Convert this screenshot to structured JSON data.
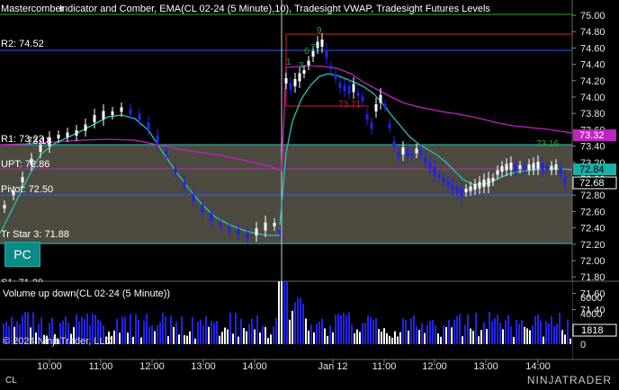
{
  "header": {
    "instrument_text": "Indicator and Comber, EMA(CL 02-24 (5 Minute),10), Tradesight VWAP, Tradesight Futures Levels",
    "overlap_text": "Mastercomber"
  },
  "levels": {
    "r2": "R2: 74.52",
    "r1": "R1: 73.23",
    "upt": "UPT: 72.86",
    "vwap_overlap": "73.18",
    "pivot": "Pivot: 72.50",
    "tr_star": "Tr Star 3: 71.88",
    "s1": "S1: 71.29",
    "comber_high": "73.71",
    "comber_right": "73.16",
    "counts": [
      "9",
      "6",
      "7",
      "1",
      "3"
    ]
  },
  "price_axis": {
    "ticks": [
      "75.00",
      "74.80",
      "74.60",
      "74.40",
      "74.20",
      "74.00",
      "73.80",
      "73.60",
      "73.40",
      "73.20",
      "73.00",
      "72.80",
      "72.60",
      "72.40",
      "72.20",
      "72.00",
      "71.80",
      "71.60",
      "71.40"
    ],
    "tag_vwap": "73.32",
    "tag_last": "72.84",
    "tag_close": "72.68",
    "tag_vwap_color": "#c023c0",
    "tag_last_color": "#18b0a8"
  },
  "volume_panel": {
    "title": "Volume up down(CL 02-24 (5 Minute))",
    "ticks": [
      "6000",
      "4000",
      "2000",
      "0"
    ],
    "tag": "1818",
    "copyright": "© 2024 NinjaTrader, LLC"
  },
  "time_axis": {
    "labels": [
      "10:00",
      "11:00",
      "12:00",
      "13:00",
      "14:00",
      "Jan 12",
      "11:00",
      "12:00",
      "13:00",
      "14:00"
    ]
  },
  "footer": {
    "instrument": "CL",
    "brand": "NINJATRADER"
  },
  "pc_button": "PC",
  "colors": {
    "up_bar": "#ffffff",
    "down_bar": "#2222ee",
    "ema": "#27c3b8",
    "vwap": "#c023c0",
    "level_blue": "#2e5cff",
    "level_red": "#d02020",
    "level_cyan": "#27c3b8",
    "zone_fill": "#4d4b40",
    "comber_green": "#2aa52a"
  }
}
